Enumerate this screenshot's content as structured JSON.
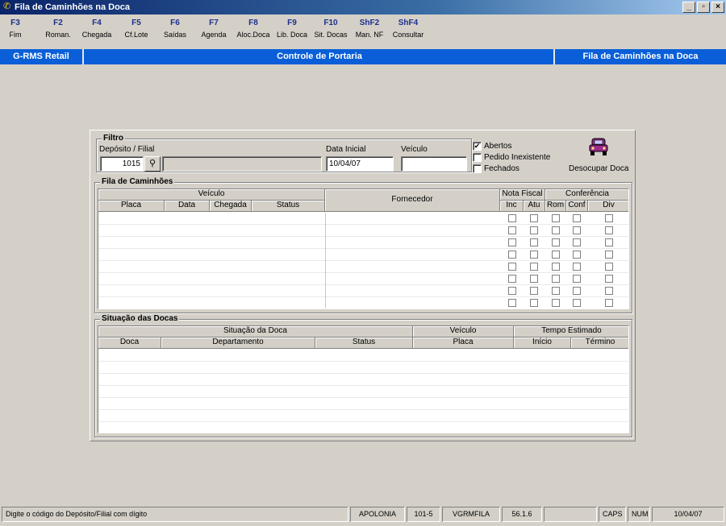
{
  "window": {
    "title": "Fila de Caminhões na Doca",
    "buttons": [
      "_",
      "▫",
      "×"
    ]
  },
  "fkeys": [
    {
      "key": "F3",
      "label": "Fim"
    },
    {
      "key": "F2",
      "label": "Roman."
    },
    {
      "key": "F4",
      "label": "Chegada"
    },
    {
      "key": "F5",
      "label": "Cf.Lote"
    },
    {
      "key": "F6",
      "label": "Saídas"
    },
    {
      "key": "F7",
      "label": "Agenda"
    },
    {
      "key": "F8",
      "label": "Aloc.Doca"
    },
    {
      "key": "F9",
      "label": "Lib. Doca"
    },
    {
      "key": "F10",
      "label": "Sit. Docas"
    },
    {
      "key": "ShF2",
      "label": "Man. NF"
    },
    {
      "key": "ShF4",
      "label": "Consultar"
    }
  ],
  "bluebar": {
    "left": "G-RMS Retail",
    "center": "Controle de Portaria",
    "right": "Fila de Caminhões na Doca"
  },
  "filtro": {
    "title": "Filtro",
    "deposito_label": "Depósito / Filial",
    "deposito_value": "1015",
    "filial_name": "",
    "data_label": "Data Inicial",
    "data_value": "10/04/07",
    "veiculo_label": "Veículo",
    "veiculo_value": ""
  },
  "options": [
    {
      "label": "Abertos",
      "checked": true
    },
    {
      "label": "Pedido Inexistente",
      "checked": false
    },
    {
      "label": "Fechados",
      "checked": false
    }
  ],
  "desocupar": {
    "label": "Desocupar Doca",
    "icon": "car-icon"
  },
  "fila": {
    "title": "Fila de Caminhões",
    "group_veiculo": "Veículo",
    "fornecedor": "Fornecedor",
    "group_nf": "Nota Fiscal",
    "group_conf": "Conferência",
    "cols": {
      "placa": "Placa",
      "data": "Data",
      "chegada": "Chegada",
      "status": "Status",
      "inc": "Inc",
      "atu": "Atu",
      "rom": "Rom",
      "conf": "Conf",
      "div": "Div"
    },
    "row_count": 8
  },
  "docas": {
    "title": "Situação das Docas",
    "group_situacao": "Situação da Doca",
    "group_veiculo": "Veículo",
    "group_tempo": "Tempo Estimado",
    "cols": {
      "doca": "Doca",
      "departamento": "Departamento",
      "status": "Status",
      "placa": "Placa",
      "inicio": "Início",
      "termino": "Término"
    },
    "row_count": 7
  },
  "status": {
    "message": "Digite o código do Depósito/Filial com dígito",
    "user": "APOLONIA",
    "code": "101-5",
    "program": "VGRMFILA",
    "version": "56.1.6",
    "empty": "",
    "caps": "CAPS",
    "num": "NUM",
    "date": "10/04/07"
  }
}
